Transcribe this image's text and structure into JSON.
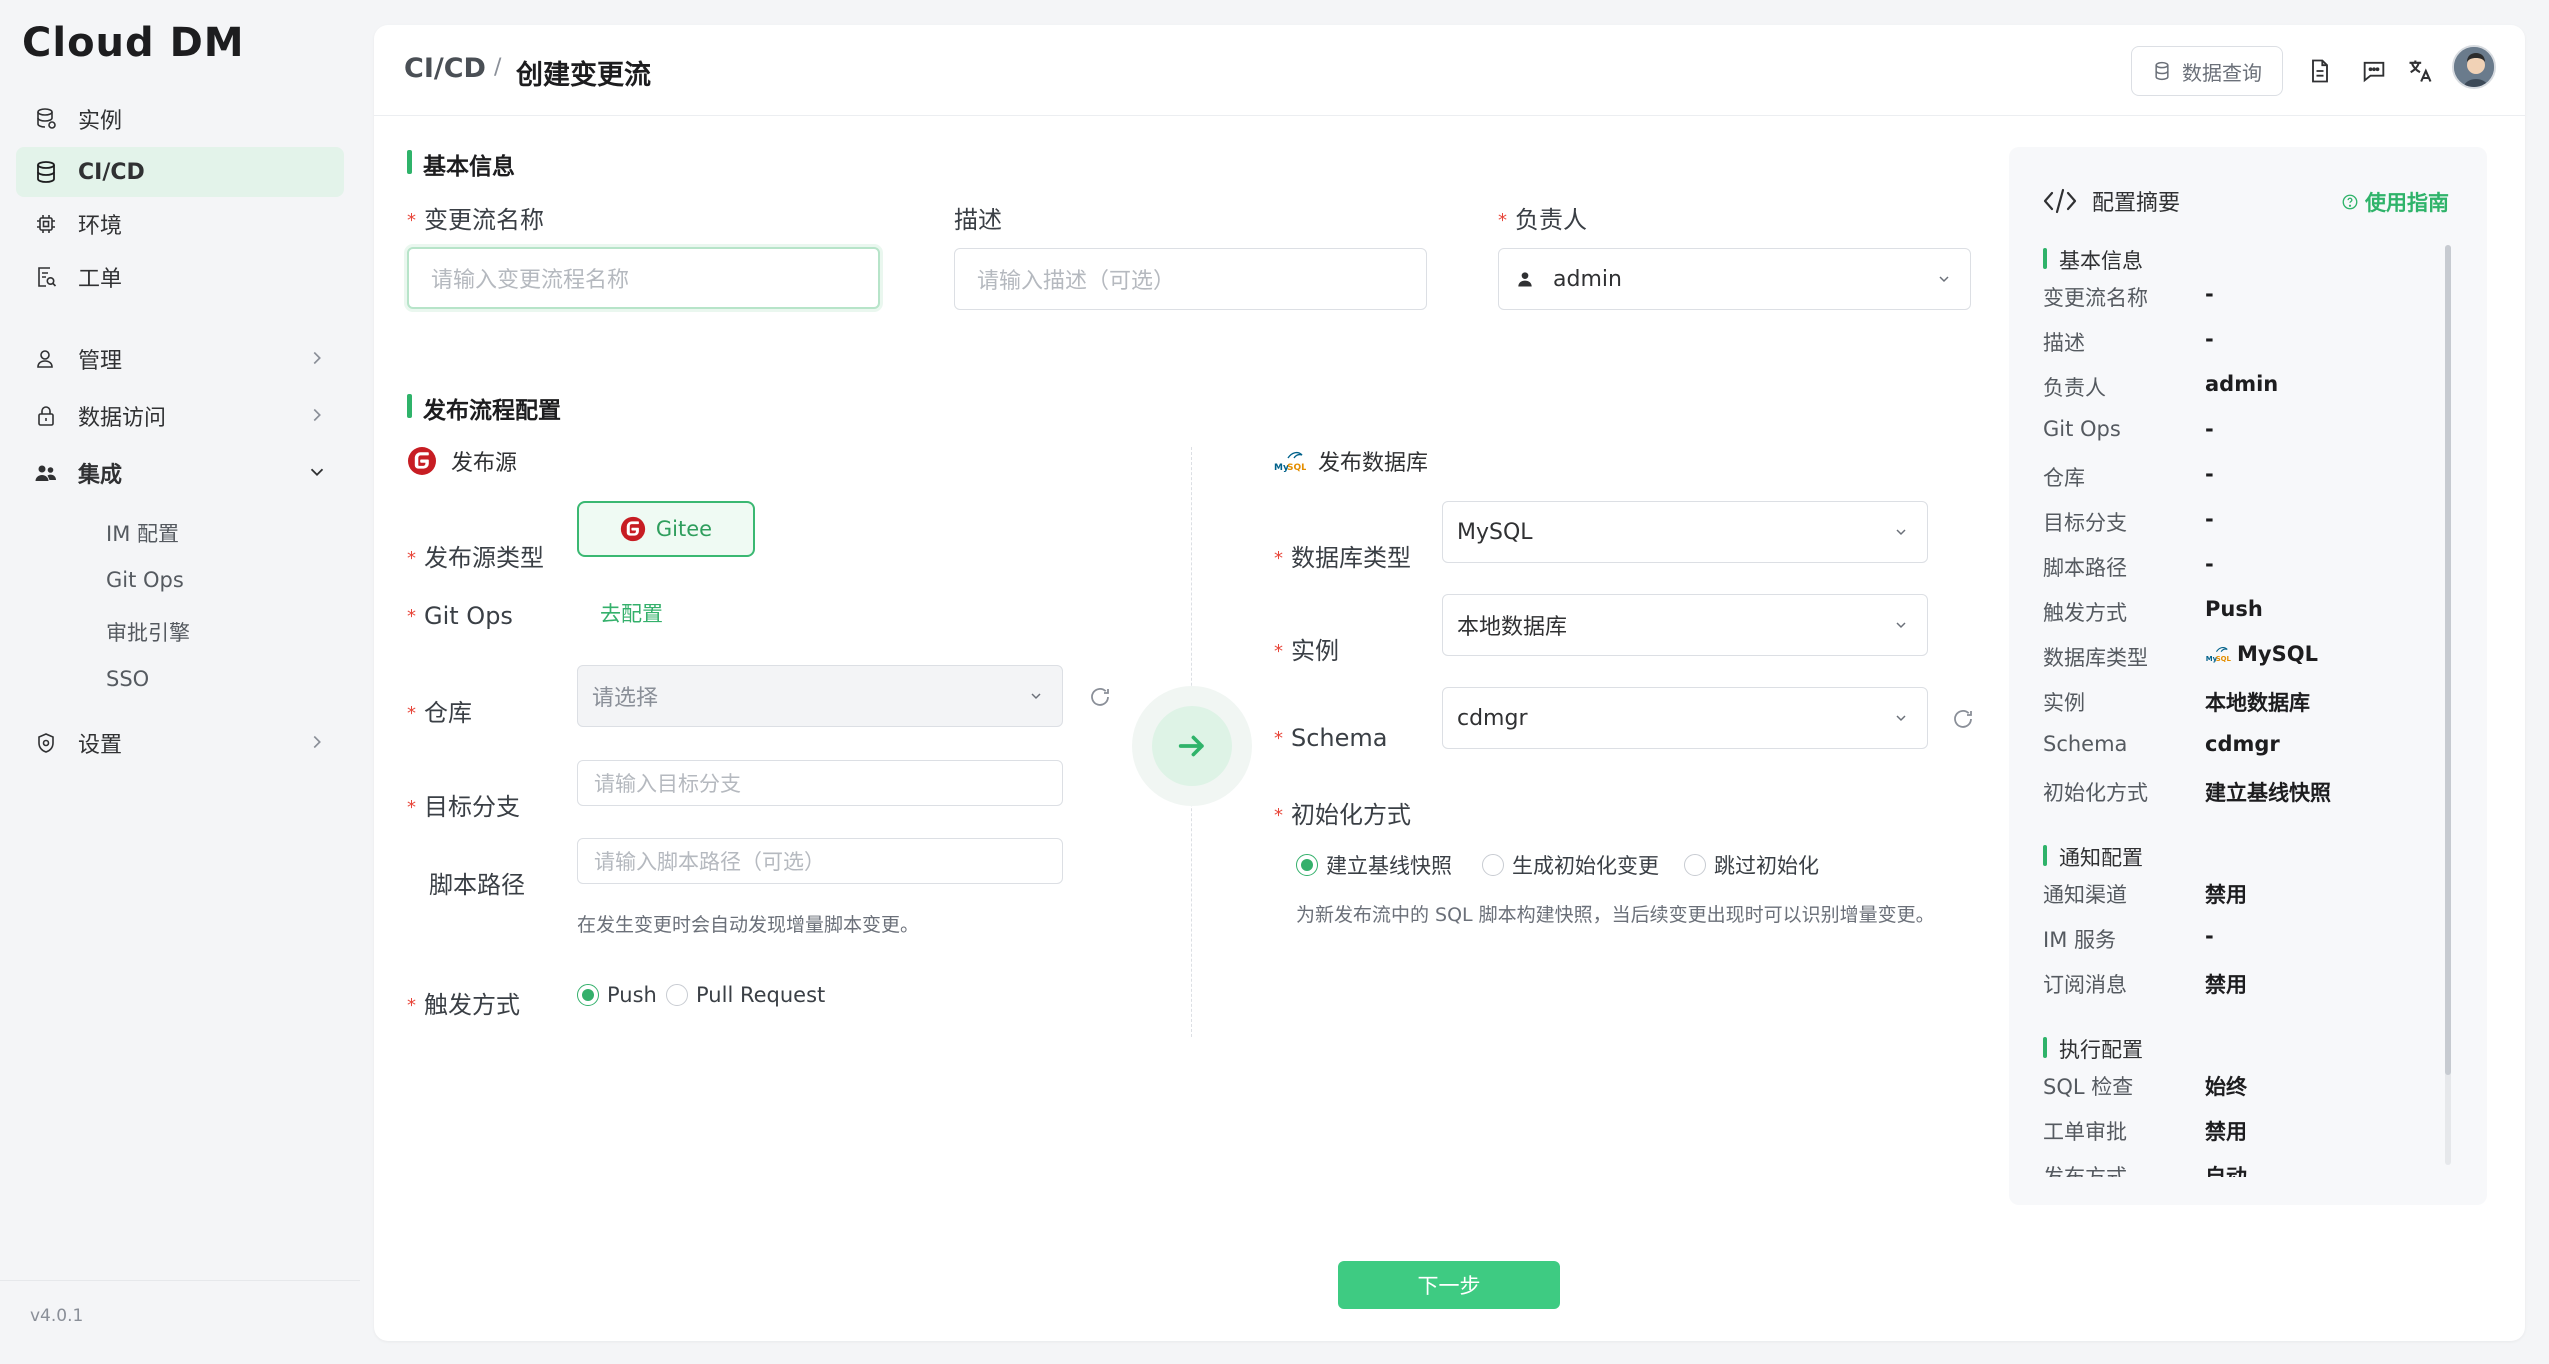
{
  "sidebar": {
    "logo": "Cloud DM",
    "items": [
      {
        "label": "实例"
      },
      {
        "label": "CI/CD"
      },
      {
        "label": "环境"
      },
      {
        "label": "工单"
      },
      {
        "label": "管理"
      },
      {
        "label": "数据访问"
      },
      {
        "label": "集成"
      },
      {
        "label": "设置"
      }
    ],
    "integration_sub": [
      "IM 配置",
      "Git Ops",
      "审批引擎",
      "SSO"
    ],
    "version": "v4.0.1"
  },
  "header": {
    "breadcrumb_root": "CI/CD",
    "breadcrumb_sep": "/",
    "breadcrumb_current": "创建变更流",
    "query_label": "数据查询"
  },
  "basic": {
    "title": "基本信息",
    "name_label": "变更流名称",
    "name_placeholder": "请输入变更流程名称",
    "desc_label": "描述",
    "desc_placeholder": "请输入描述（可选）",
    "owner_label": "负责人",
    "owner_value": "admin"
  },
  "publish": {
    "title": "发布流程配置",
    "source_title": "发布源",
    "source_type_label": "发布源类型",
    "source_type_value": "Gitee",
    "gitops_label": "Git Ops",
    "gitops_link": "去配置",
    "repo_label": "仓库",
    "repo_placeholder": "请选择",
    "branch_label": "目标分支",
    "branch_placeholder": "请输入目标分支",
    "path_label": "脚本路径",
    "path_placeholder": "请输入脚本路径（可选）",
    "path_hint": "在发生变更时会自动发现增量脚本变更。",
    "trigger_label": "触发方式",
    "trigger_options": [
      "Push",
      "Pull Request"
    ],
    "trigger_selected": "Push",
    "db_title": "发布数据库",
    "db_type_label": "数据库类型",
    "db_type_value": "MySQL",
    "instance_label": "实例",
    "instance_value": "本地数据库",
    "schema_label": "Schema",
    "schema_value": "cdmgr",
    "init_label": "初始化方式",
    "init_options": [
      "建立基线快照",
      "生成初始化变更",
      "跳过初始化"
    ],
    "init_selected": "建立基线快照",
    "init_hint": "为新发布流中的 SQL 脚本构建快照，当后续变更出现时可以识别增量变更。"
  },
  "summary": {
    "title": "配置摘要",
    "guide": "使用指南",
    "sections": [
      {
        "title": "基本信息",
        "rows": [
          {
            "k": "变更流名称",
            "v": "-"
          },
          {
            "k": "描述",
            "v": "-"
          },
          {
            "k": "负责人",
            "v": "admin"
          },
          {
            "k": "Git Ops",
            "v": "-"
          },
          {
            "k": "仓库",
            "v": "-"
          },
          {
            "k": "目标分支",
            "v": "-"
          },
          {
            "k": "脚本路径",
            "v": "-"
          },
          {
            "k": "触发方式",
            "v": "Push"
          },
          {
            "k": "数据库类型",
            "v": "MySQL"
          },
          {
            "k": "实例",
            "v": "本地数据库"
          },
          {
            "k": "Schema",
            "v": "cdmgr"
          },
          {
            "k": "初始化方式",
            "v": "建立基线快照"
          }
        ]
      },
      {
        "title": "通知配置",
        "rows": [
          {
            "k": "通知渠道",
            "v": "禁用"
          },
          {
            "k": "IM 服务",
            "v": "-"
          },
          {
            "k": "订阅消息",
            "v": "禁用"
          }
        ]
      },
      {
        "title": "执行配置",
        "rows": [
          {
            "k": "SQL 检查",
            "v": "始终"
          },
          {
            "k": "工单审批",
            "v": "禁用"
          },
          {
            "k": "发布方式",
            "v": "自动"
          }
        ]
      }
    ]
  },
  "footer": {
    "next_label": "下一步"
  },
  "colors": {
    "accent": "#2fb36a",
    "required": "#e8463a",
    "active_nav_bg": "#e3f3ea",
    "next_button": "#3ecb82"
  }
}
